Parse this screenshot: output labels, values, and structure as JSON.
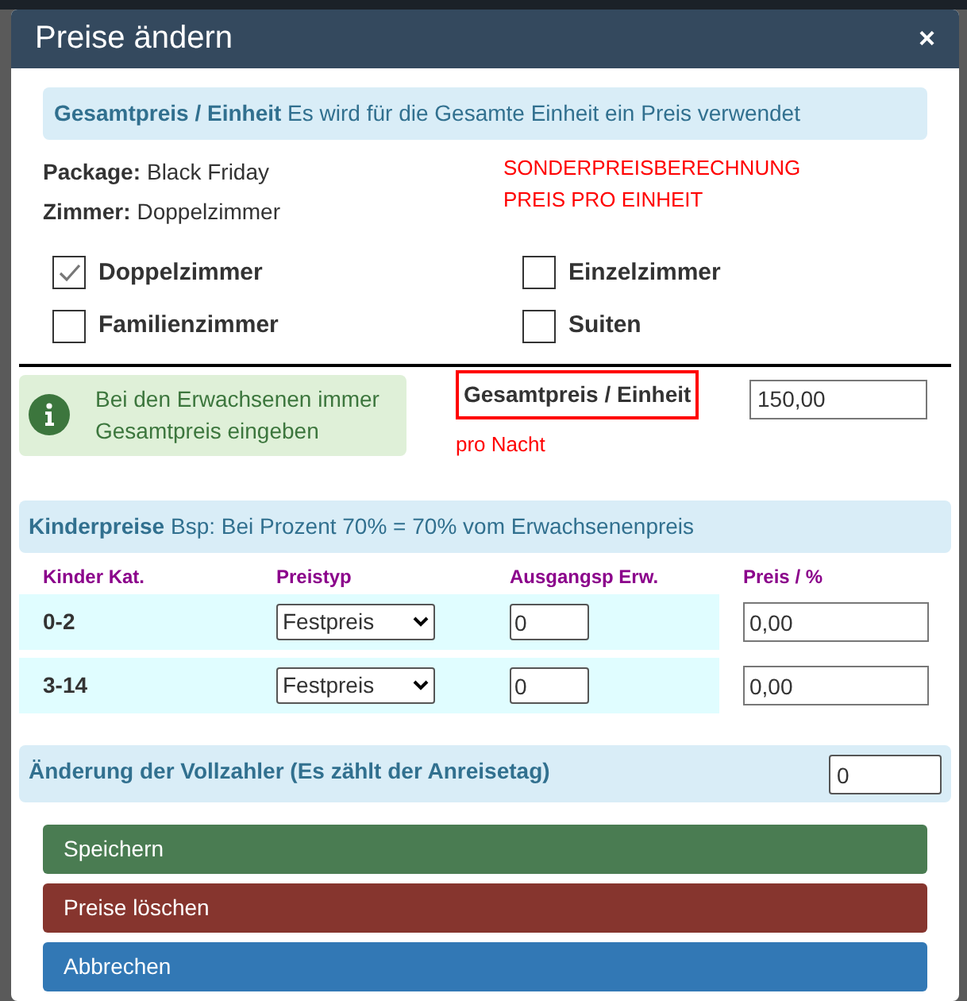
{
  "dialog": {
    "title": "Preise ändern",
    "close": "×"
  },
  "info_banner": {
    "text": "**Gesamtpreis / Einheit** Es wird für die Gesamte Einheit ein Preis verwendet"
  },
  "details": [
    {
      "label": "Package:",
      "value": "Black Friday"
    },
    {
      "label": "Zimmer:",
      "value": "Doppelzimmer"
    }
  ],
  "notice_lines": [
    "SONDERPREISBERECHNUNG",
    "PREIS PRO EINHEIT"
  ],
  "rooms": [
    {
      "label": "Doppelzimmer",
      "checked": true
    },
    {
      "label": "Einzelzimmer",
      "checked": false
    },
    {
      "label": "Familienzimmer",
      "checked": false
    },
    {
      "label": "Suiten",
      "checked": false
    }
  ],
  "adult_hint": "Bei den Erwachsenen immer Gesamtpreis eingeben",
  "total_price": {
    "label": "Gesamtpreis / Einheit",
    "value": "150,00",
    "note": "pro Nacht"
  },
  "children_banner": {
    "text": "**Kinderpreise** Bsp: Bei Prozent 70% = 70% vom Erwachsenenpreis"
  },
  "children_table": {
    "columns": [
      "Kinder Kat.",
      "Preistyp",
      "Ausgangsp Erw.",
      "Preis / %"
    ],
    "rows": [
      {
        "category": "0-2",
        "price_type": "Festpreis",
        "base": "0",
        "price": "0,00"
      },
      {
        "category": "3-14",
        "price_type": "Festpreis",
        "base": "0",
        "price": "0,00"
      }
    ]
  },
  "full_payers": {
    "label": "Änderung der Vollzahler (Es zählt der Anreisetag)",
    "value": "0"
  },
  "buttons": [
    {
      "label": "Speichern",
      "kind": "success"
    },
    {
      "label": "Preise löschen",
      "kind": "danger"
    },
    {
      "label": "Abbrechen",
      "kind": "primary"
    }
  ]
}
